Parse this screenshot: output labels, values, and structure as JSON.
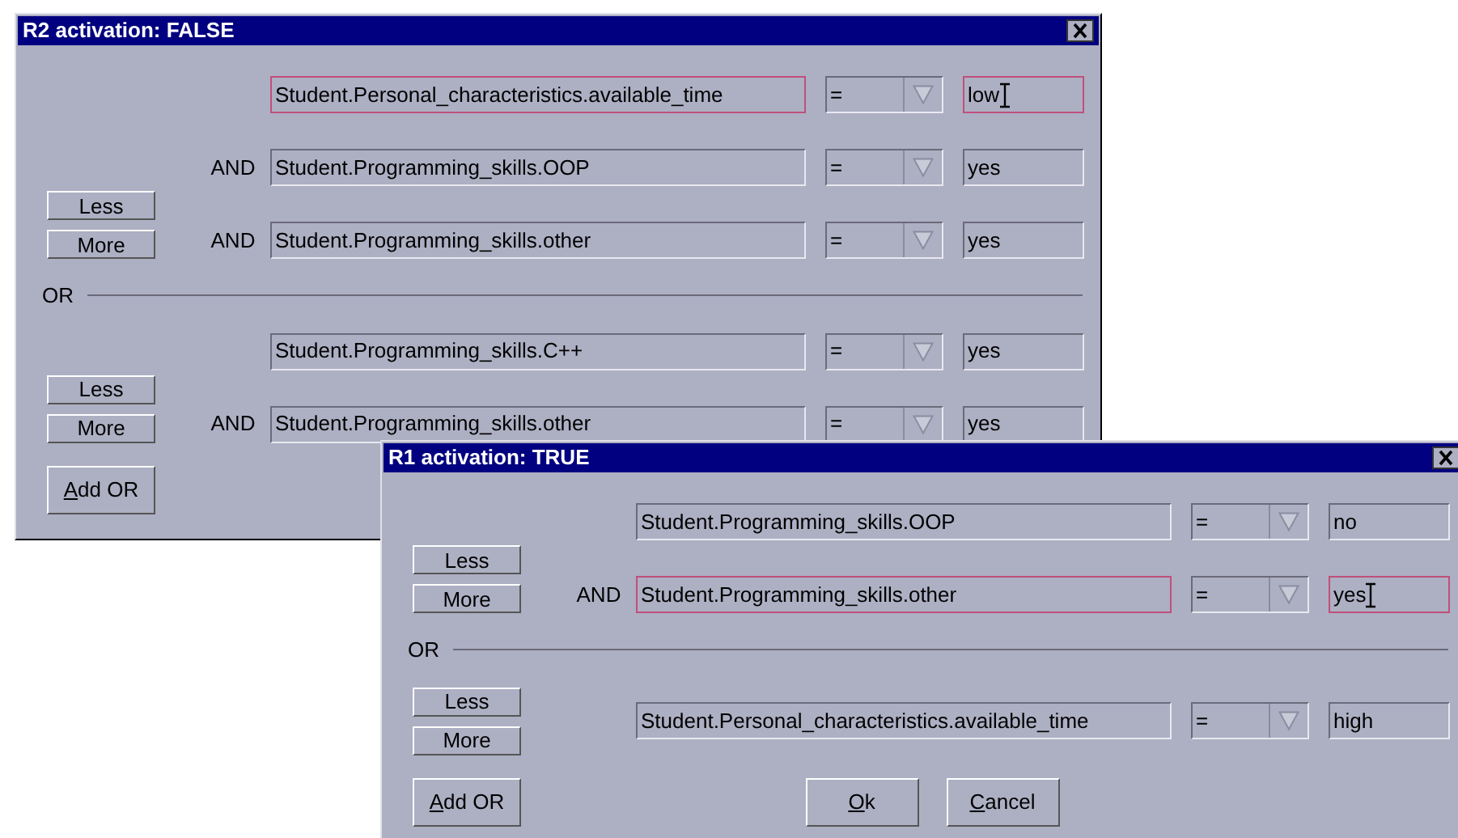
{
  "windows": [
    {
      "title": "R2 activation: FALSE",
      "groups": [
        {
          "buttons": [
            {
              "label": "Less"
            },
            {
              "label": "More"
            }
          ],
          "rows": [
            {
              "attribute": "Student.Personal_characteristics.available_time",
              "operator": "=",
              "value": "low",
              "focused": true
            },
            {
              "connector": "AND",
              "attribute": "Student.Programming_skills.OOP",
              "operator": "=",
              "value": "yes",
              "focused": false
            },
            {
              "connector": "AND",
              "attribute": "Student.Programming_skills.other",
              "operator": "=",
              "value": "yes",
              "focused": false
            }
          ]
        },
        {
          "separator": "OR",
          "buttons": [
            {
              "label": "Less"
            },
            {
              "label": "More"
            }
          ],
          "rows": [
            {
              "attribute": "Student.Programming_skills.C++",
              "operator": "=",
              "value": "yes",
              "focused": false
            },
            {
              "connector": "AND",
              "attribute": "Student.Programming_skills.other",
              "operator": "=",
              "value": "yes",
              "focused": false
            }
          ]
        }
      ],
      "footer_buttons": [
        {
          "label": "Add OR",
          "kind": "side",
          "mnemonic": true
        }
      ]
    },
    {
      "title": "R1 activation: TRUE",
      "groups": [
        {
          "buttons": [
            {
              "label": "Less"
            },
            {
              "label": "More"
            }
          ],
          "rows": [
            {
              "attribute": "Student.Programming_skills.OOP",
              "operator": "=",
              "value": "no",
              "focused": false
            },
            {
              "connector": "AND",
              "attribute": "Student.Programming_skills.other",
              "operator": "=",
              "value": "yes",
              "focused": true
            }
          ]
        },
        {
          "separator": "OR",
          "buttons": [
            {
              "label": "Less"
            },
            {
              "label": "More"
            }
          ],
          "rows": [
            {
              "attribute": "Student.Personal_characteristics.available_time",
              "operator": "=",
              "value": "high",
              "focused": false
            }
          ]
        }
      ],
      "footer_buttons": [
        {
          "label": "Add OR",
          "kind": "side",
          "mnemonic": true
        },
        {
          "label": "Ok",
          "kind": "dialog",
          "mnemonic": true
        },
        {
          "label": "Cancel",
          "kind": "dialog",
          "mnemonic": true
        }
      ]
    }
  ]
}
